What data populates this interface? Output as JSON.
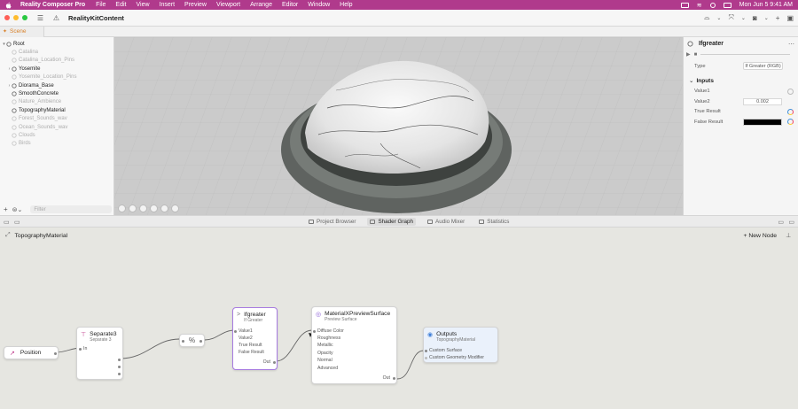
{
  "menubar": {
    "app_name": "Reality Composer Pro",
    "items": [
      "File",
      "Edit",
      "View",
      "Insert",
      "Preview",
      "Viewport",
      "Arrange",
      "Editor",
      "Window",
      "Help"
    ],
    "datetime": "Mon Jun 5  9:41 AM"
  },
  "toolbar": {
    "title": "RealityKitContent",
    "traffic_colors": [
      "#ff5f57",
      "#febc2e",
      "#28c840"
    ]
  },
  "scene_tab": {
    "label": "Scene"
  },
  "outline": {
    "items": [
      {
        "label": "Root",
        "dim": false,
        "arrow": "▾",
        "indent": 0
      },
      {
        "label": "Catalina",
        "dim": true,
        "arrow": "",
        "indent": 1
      },
      {
        "label": "Catalina_Location_Pins",
        "dim": true,
        "arrow": "",
        "indent": 1
      },
      {
        "label": "Yosemite",
        "dim": false,
        "arrow": "›",
        "indent": 1
      },
      {
        "label": "Yosemite_Location_Pins",
        "dim": true,
        "arrow": "",
        "indent": 1
      },
      {
        "label": "Diorama_Base",
        "dim": false,
        "arrow": "›",
        "indent": 1
      },
      {
        "label": "SmoothConcrete",
        "dim": false,
        "arrow": "",
        "indent": 1
      },
      {
        "label": "Nature_Ambience",
        "dim": true,
        "arrow": "",
        "indent": 1
      },
      {
        "label": "TopographyMaterial",
        "dim": false,
        "arrow": "",
        "indent": 1
      },
      {
        "label": "Forest_Sounds_wav",
        "dim": true,
        "arrow": "",
        "indent": 1
      },
      {
        "label": "Ocean_Sounds_wav",
        "dim": true,
        "arrow": "",
        "indent": 1
      },
      {
        "label": "Clouds",
        "dim": true,
        "arrow": "",
        "indent": 1
      },
      {
        "label": "Birds",
        "dim": true,
        "arrow": "",
        "indent": 1
      }
    ],
    "filter_placeholder": "Filter"
  },
  "inspector": {
    "title": "Ifgreater",
    "type_label": "Type",
    "type_value": "If Greater (RGB)",
    "inputs_label": "Inputs",
    "value1_label": "Value1",
    "value2_label": "Value2",
    "value2": "0.002",
    "true_label": "True Result",
    "false_label": "False Result",
    "false_color": "#000000"
  },
  "bottom_tabs": [
    "Project Browser",
    "Shader Graph",
    "Audio Mixer",
    "Statistics"
  ],
  "graph": {
    "material": "TopographyMaterial",
    "new_node": "New Node",
    "nodes": {
      "position": {
        "title": "Position"
      },
      "separate": {
        "title": "Separate3",
        "sub": "Separate 3",
        "in": "In"
      },
      "percent": {
        "title": "%"
      },
      "ifgreater": {
        "title": "Ifgreater",
        "sub": "If Greater",
        "ports": [
          "Value1",
          "Value2",
          "True Result",
          "False Result"
        ],
        "out": "Out"
      },
      "material": {
        "title": "MaterialXPreviewSurface",
        "sub": "Preview Surface",
        "ports": [
          "Diffuse Color",
          "Roughness",
          "Metallic",
          "Opacity",
          "Normal",
          "Advanced"
        ],
        "out": "Out"
      },
      "outputs": {
        "title": "Outputs",
        "sub": "TopographyMaterial",
        "ports": [
          "Custom Surface",
          "Custom Geometry Modifier"
        ]
      }
    }
  }
}
